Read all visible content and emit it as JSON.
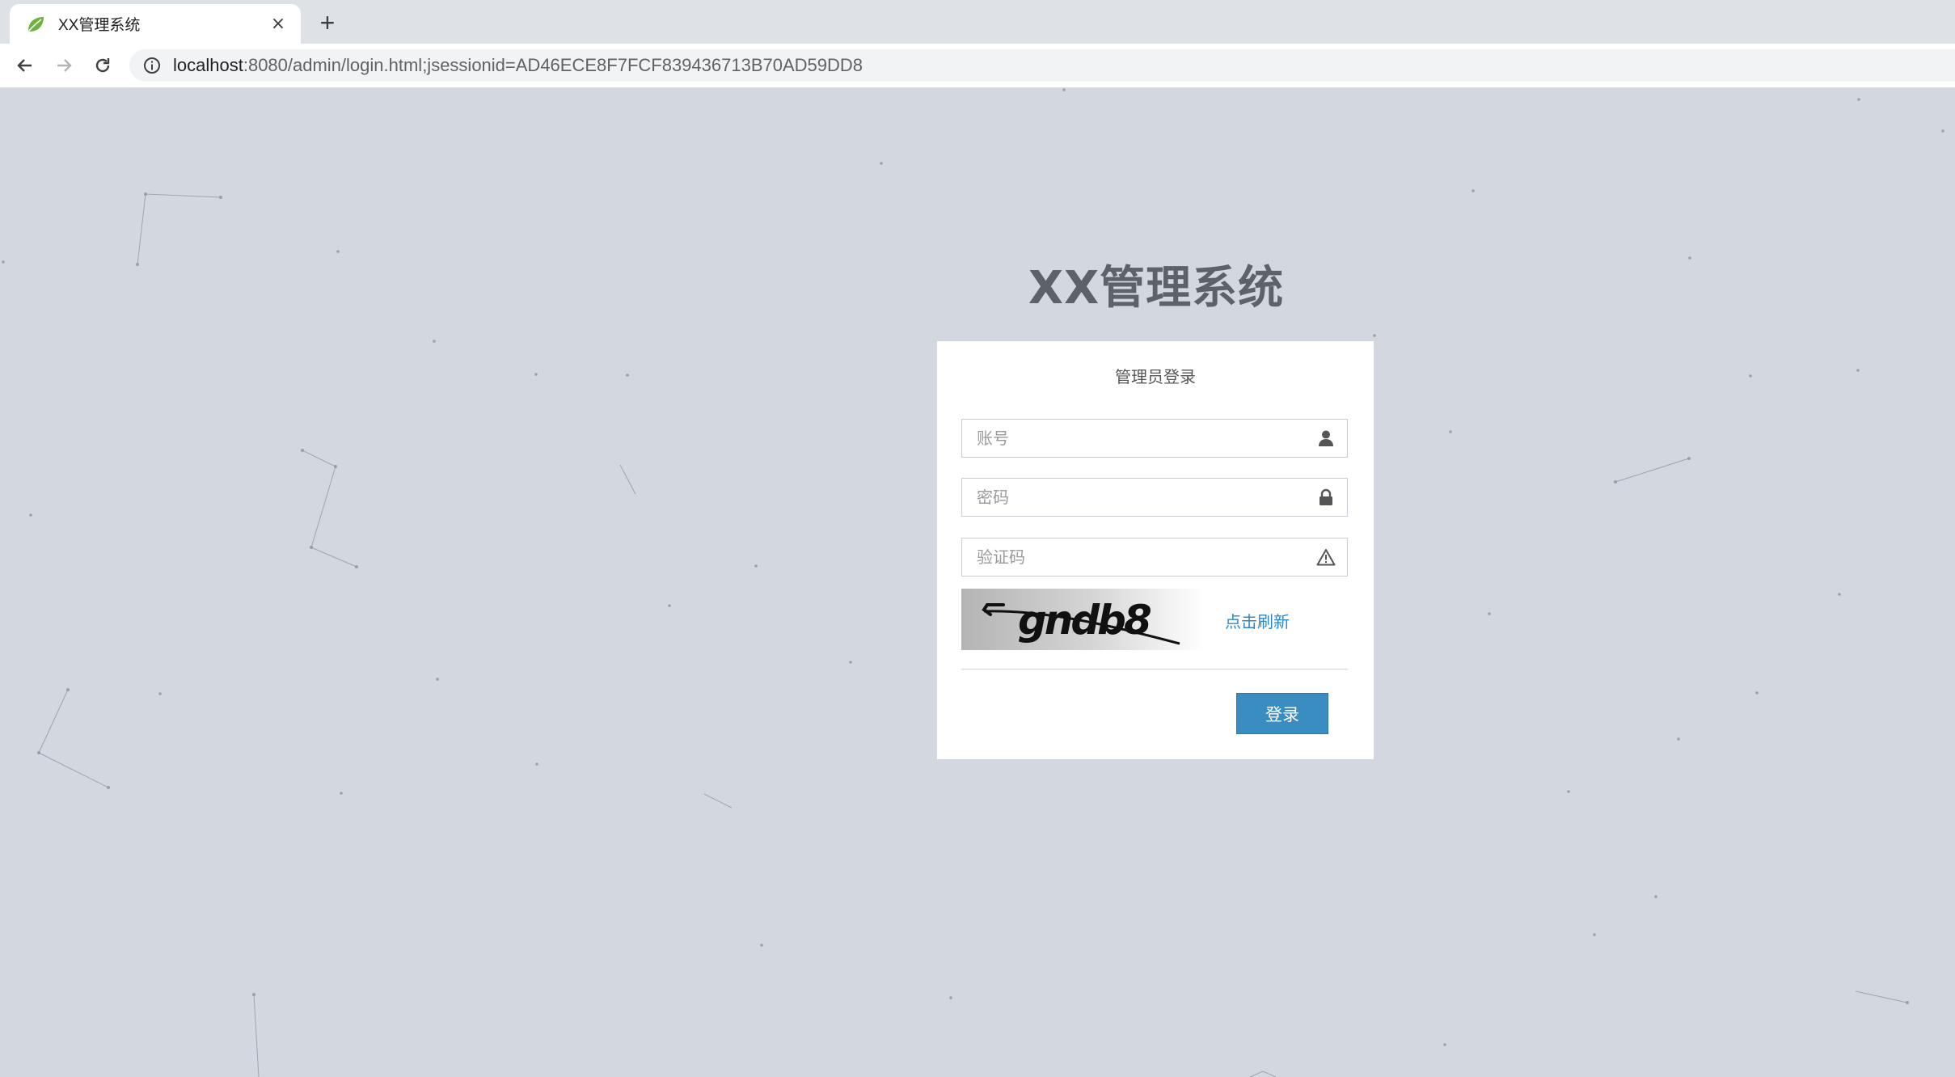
{
  "browser": {
    "tab_title": "XX管理系统",
    "tab_close": "×",
    "new_tab": "+",
    "url_host": "localhost",
    "url_rest": ":8080/admin/login.html;jsessionid=AD46ECE8F7FCF839436713B70AD59DD8"
  },
  "login": {
    "system_title": "XX管理系统",
    "card_title": "管理员登录",
    "username_placeholder": "账号",
    "password_placeholder": "密码",
    "captcha_placeholder": "验证码",
    "captcha_text": "gndb8",
    "refresh_label": "点击刷新",
    "submit_label": "登录"
  },
  "icons": {
    "username": "user-icon",
    "password": "lock-icon",
    "captcha": "warning-icon"
  },
  "colors": {
    "page_background": "#d3d7e0",
    "title": "#5d6168",
    "button": "#3a8dc0",
    "link": "#2f86c5"
  }
}
